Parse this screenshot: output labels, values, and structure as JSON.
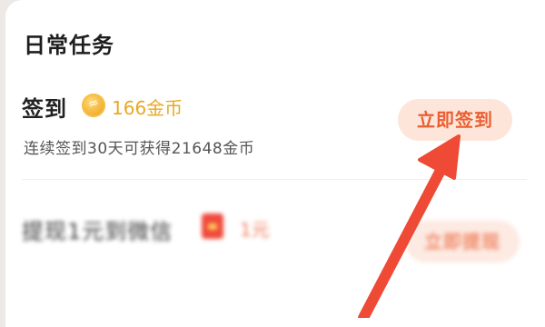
{
  "section": {
    "title": "日常任务"
  },
  "tasks": [
    {
      "name": "签到",
      "reward": "166金币",
      "description": "连续签到30天可获得21648金币",
      "button": "立即签到"
    },
    {
      "name": "提现1元到微信",
      "reward": "1元",
      "description": "",
      "button": "立即提现"
    }
  ],
  "icons": {
    "coin": "coin-icon",
    "envelope": "red-envelope-icon",
    "arrow": "annotation-arrow-icon"
  },
  "colors": {
    "accent": "#ea5f33",
    "button_bg": "#fde6d9",
    "coin_text": "#e8a824",
    "annotation_arrow": "#ee4a36"
  }
}
